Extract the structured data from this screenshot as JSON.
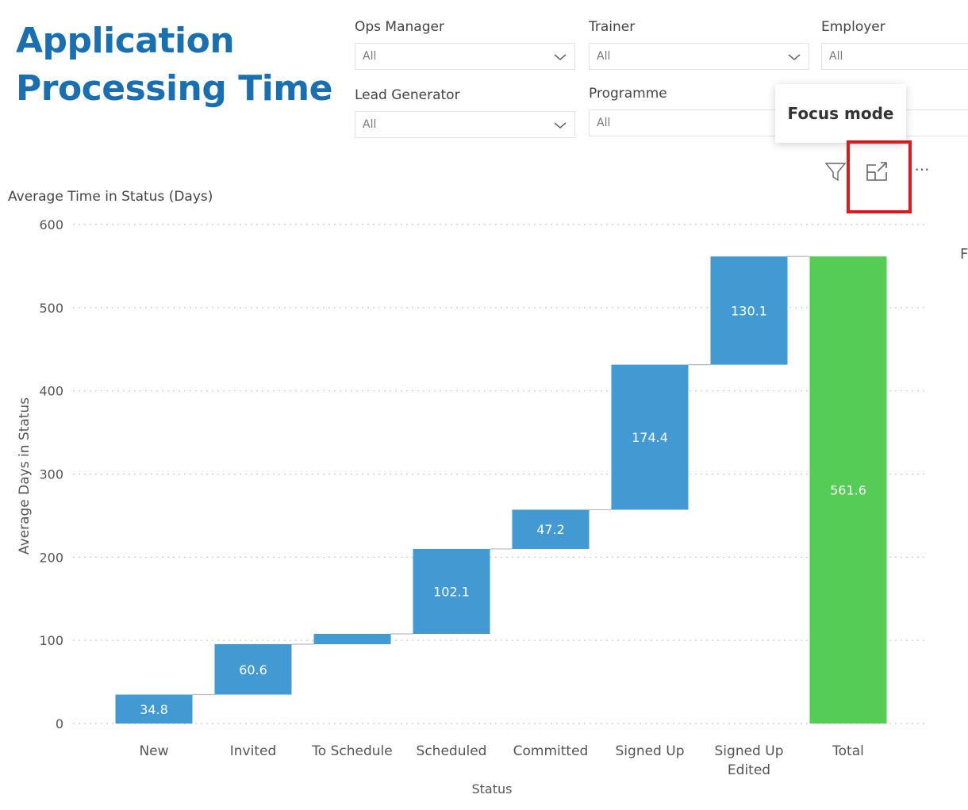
{
  "page": {
    "title": "Application\nProcessing Time",
    "edge_letter": "F"
  },
  "slicers": [
    {
      "label": "Ops Manager",
      "value": "All"
    },
    {
      "label": "Trainer",
      "value": "All"
    },
    {
      "label": "Employer",
      "value": "All"
    },
    {
      "label": "Lead Generator",
      "value": "All"
    },
    {
      "label": "Programme",
      "value": "All"
    }
  ],
  "visual_header": {
    "tooltip": "Focus mode",
    "filter_icon": "filter-icon",
    "focus_icon": "focus-mode-icon",
    "more_icon": "more-options-icon",
    "more_label": "···"
  },
  "chart_data": {
    "type": "waterfall",
    "title": "Average Time in Status (Days)",
    "ylabel": "Average Days in Status",
    "xlabel": "Status",
    "ylim": [
      0,
      600
    ],
    "yticks": [
      0,
      100,
      200,
      300,
      400,
      500,
      600
    ],
    "categories": [
      "New",
      "Invited",
      "To Schedule",
      "Scheduled",
      "Committed",
      "Signed Up",
      "Signed Up\nEdited",
      "Total"
    ],
    "values": [
      34.8,
      60.6,
      12.4,
      102.1,
      47.2,
      174.4,
      130.1,
      561.6
    ],
    "labels": [
      "34.8",
      "60.6",
      "",
      "102.1",
      "47.2",
      "174.4",
      "130.1",
      "561.6"
    ],
    "increase_color": "#4399d1",
    "total_color": "#55cc55",
    "grid": true
  }
}
